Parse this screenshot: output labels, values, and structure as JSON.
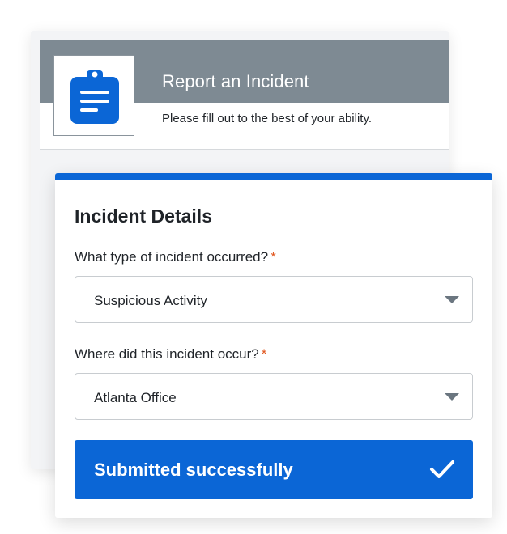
{
  "header": {
    "title": "Report an Incident",
    "subtitle": "Please fill out to the best of your ability.",
    "logo_icon": "clipboard-icon"
  },
  "form": {
    "section_title": "Incident Details",
    "fields": [
      {
        "label": "What type of incident occurred?",
        "required_marker": "*",
        "value": "Suspicious Activity",
        "icon": "chevron-down-icon"
      },
      {
        "label": "Where did this incident occur?",
        "required_marker": "*",
        "value": "Atlanta Office",
        "icon": "chevron-down-icon"
      }
    ],
    "submit": {
      "label": "Submitted successfully",
      "icon": "check-icon"
    }
  },
  "colors": {
    "accent": "#0b66d6",
    "header_bg": "#7e8a93",
    "required": "#e0541b"
  }
}
